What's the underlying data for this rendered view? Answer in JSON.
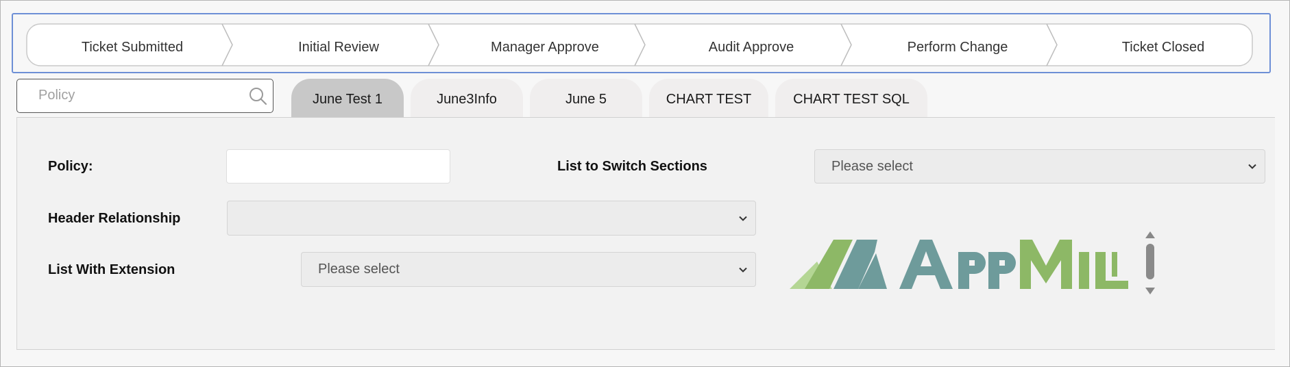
{
  "workflow": {
    "steps": [
      {
        "label": "Ticket Submitted"
      },
      {
        "label": "Initial Review"
      },
      {
        "label": "Manager Approve"
      },
      {
        "label": "Audit Approve"
      },
      {
        "label": "Perform Change"
      },
      {
        "label": "Ticket Closed"
      }
    ]
  },
  "search": {
    "placeholder": "Policy",
    "value": ""
  },
  "tabs": [
    {
      "label": "June Test 1",
      "active": true
    },
    {
      "label": "June3Info",
      "active": false
    },
    {
      "label": "June 5",
      "active": false
    },
    {
      "label": "CHART TEST",
      "active": false
    },
    {
      "label": "CHART TEST SQL",
      "active": false
    }
  ],
  "form": {
    "policy": {
      "label": "Policy:",
      "value": ""
    },
    "list_switch": {
      "label": "List to Switch Sections",
      "value": "Please select"
    },
    "header_relationship": {
      "label": "Header Relationship",
      "value": ""
    },
    "list_extension": {
      "label": "List With Extension",
      "value": "Please select"
    }
  },
  "logo": {
    "name": "AppMill",
    "colors": {
      "teal": "#6e9b9b",
      "green": "#8db866",
      "light_green": "#b4d694"
    }
  },
  "colors": {
    "workflow_border": "#6d8fd6",
    "tab_active": "#c8c8c8",
    "tab_inactive": "#f0eeee"
  },
  "icons": {
    "search": "search-icon",
    "dropdown": "chevron-down-icon",
    "scroll_up": "scroll-up-icon",
    "scroll_down": "scroll-down-icon"
  }
}
